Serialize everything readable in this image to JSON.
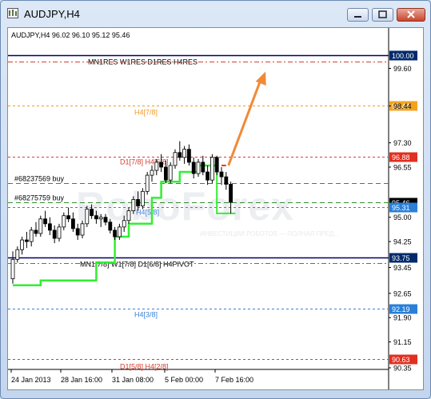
{
  "window": {
    "title": "AUDJPY,H4",
    "buttons": [
      "minimize",
      "maximize",
      "close"
    ]
  },
  "chart_info": "AUDJPY,H4  96.02 96.10 95.12 95.46",
  "watermark": "RoboForex",
  "watermark_sub": "ИНВЕСТИЦИИ РОБОТОВ — ПОЛНАЯ ПРЕД...",
  "colors": {
    "bg": "#ffffff",
    "candle": "#000000",
    "ma": "#33ee33",
    "red": "#d64030",
    "orange": "#f39a2a",
    "green_dash": "#2f8f2f",
    "blue_dash": "#3a7fd6",
    "navy": "#000066",
    "arrow": "#f08a38",
    "label_navy": "#002a6b",
    "label_red": "#e03020",
    "label_orange": "#f4a21c",
    "label_blue": "#2a7fd8",
    "label_dark": "#000000"
  },
  "chart_data": {
    "type": "candlestick",
    "symbol": "AUDJPY",
    "timeframe": "H4",
    "y_ticks": [
      "99.60",
      "98.44",
      "97.30",
      "96.55",
      "95.00",
      "94.25",
      "93.45",
      "92.65",
      "91.90",
      "91.15",
      "90.35"
    ],
    "y_range": [
      90.35,
      100.6
    ],
    "x_ticks": [
      "24 Jan 2013",
      "28 Jan 16:00",
      "31 Jan 08:00",
      "5 Feb 00:00",
      "7 Feb 16:00"
    ],
    "levels": [
      {
        "price": 100.0,
        "text": "MN1RES W1RES D1RES H4RES",
        "label": "100.00",
        "kind": "navy"
      },
      {
        "price": 99.82,
        "text": "",
        "label": "",
        "kind": "reddash"
      },
      {
        "price": 98.44,
        "text": "H4[7/8]",
        "label": "98.44",
        "kind": "orange"
      },
      {
        "price": 96.88,
        "text": "D1[7/8] H4[6/8]",
        "label": "96.88",
        "kind": "red"
      },
      {
        "price": 96.05,
        "text": "#68237569 buy",
        "label": "",
        "kind": "green"
      },
      {
        "price": 95.46,
        "text": "#68275759 buy",
        "label": "95.46",
        "kind": "greenblack"
      },
      {
        "price": 95.31,
        "text": "H4[5/8]",
        "label": "95.31",
        "kind": "blue"
      },
      {
        "price": 93.75,
        "text": "MN1[7/8] W1[7/8] D1[6/8] H4PIVOT",
        "label": "93.75",
        "kind": "navy"
      },
      {
        "price": 93.58,
        "text": "",
        "label": "",
        "kind": "reddash"
      },
      {
        "price": 92.19,
        "text": "H4[3/8]",
        "label": "92.19",
        "kind": "blue"
      },
      {
        "price": 90.63,
        "text": "D1[5/8] H4[2/8]",
        "label": "90.63",
        "kind": "red"
      }
    ],
    "candles": [
      [
        93.1,
        93.95,
        92.95,
        93.7
      ],
      [
        93.7,
        94.1,
        93.6,
        94.0
      ],
      [
        94.0,
        94.4,
        93.85,
        94.3
      ],
      [
        94.3,
        94.55,
        94.05,
        94.25
      ],
      [
        94.25,
        94.7,
        94.1,
        94.6
      ],
      [
        94.6,
        94.85,
        94.4,
        94.5
      ],
      [
        94.5,
        95.05,
        94.4,
        94.95
      ],
      [
        94.95,
        95.2,
        94.7,
        94.8
      ],
      [
        94.8,
        95.0,
        94.45,
        94.6
      ],
      [
        94.6,
        94.75,
        94.2,
        94.35
      ],
      [
        94.35,
        94.8,
        94.25,
        94.7
      ],
      [
        94.7,
        95.15,
        94.6,
        95.05
      ],
      [
        95.05,
        95.3,
        94.85,
        94.95
      ],
      [
        94.95,
        95.15,
        94.55,
        94.65
      ],
      [
        94.65,
        94.8,
        94.3,
        94.45
      ],
      [
        94.45,
        94.9,
        94.35,
        94.8
      ],
      [
        94.8,
        95.35,
        94.7,
        95.25
      ],
      [
        95.25,
        95.4,
        94.95,
        95.05
      ],
      [
        95.05,
        95.2,
        94.8,
        94.95
      ],
      [
        94.95,
        95.1,
        94.7,
        95.0
      ],
      [
        95.0,
        95.1,
        94.75,
        94.85
      ],
      [
        94.85,
        94.95,
        94.5,
        94.6
      ],
      [
        94.6,
        94.7,
        94.3,
        94.4
      ],
      [
        94.4,
        94.8,
        94.3,
        94.7
      ],
      [
        94.7,
        95.05,
        94.55,
        94.9
      ],
      [
        94.9,
        95.3,
        94.8,
        95.2
      ],
      [
        95.2,
        95.65,
        95.1,
        95.55
      ],
      [
        95.55,
        95.8,
        95.2,
        95.35
      ],
      [
        95.35,
        95.9,
        95.25,
        95.8
      ],
      [
        95.8,
        96.4,
        95.7,
        96.3
      ],
      [
        96.3,
        96.6,
        96.1,
        96.45
      ],
      [
        96.45,
        96.8,
        96.3,
        96.7
      ],
      [
        96.7,
        96.95,
        96.4,
        96.55
      ],
      [
        96.55,
        96.75,
        96.05,
        96.15
      ],
      [
        96.15,
        96.7,
        96.05,
        96.6
      ],
      [
        96.6,
        97.1,
        96.5,
        97.0
      ],
      [
        97.0,
        97.35,
        96.75,
        96.85
      ],
      [
        96.85,
        97.2,
        96.65,
        97.1
      ],
      [
        97.1,
        97.25,
        96.6,
        96.7
      ],
      [
        96.7,
        96.85,
        96.2,
        96.35
      ],
      [
        96.35,
        96.8,
        96.25,
        96.7
      ],
      [
        96.7,
        96.9,
        96.3,
        96.4
      ],
      [
        96.4,
        96.6,
        96.0,
        96.15
      ],
      [
        96.15,
        96.95,
        96.05,
        96.85
      ],
      [
        96.85,
        96.9,
        96.3,
        96.4
      ],
      [
        96.4,
        96.55,
        96.0,
        96.25
      ],
      [
        96.25,
        96.4,
        95.85,
        96.02
      ],
      [
        96.02,
        96.1,
        95.12,
        95.46
      ]
    ],
    "ma": [
      {
        "i": 0,
        "v": 92.9
      },
      {
        "i": 6,
        "v": 92.9
      },
      {
        "i": 6,
        "v": 93.05
      },
      {
        "i": 18,
        "v": 93.05
      },
      {
        "i": 18,
        "v": 93.6
      },
      {
        "i": 22,
        "v": 93.6
      },
      {
        "i": 22,
        "v": 94.4
      },
      {
        "i": 25,
        "v": 94.4
      },
      {
        "i": 25,
        "v": 94.8
      },
      {
        "i": 30,
        "v": 94.8
      },
      {
        "i": 30,
        "v": 95.6
      },
      {
        "i": 32,
        "v": 95.6
      },
      {
        "i": 32,
        "v": 96.1
      },
      {
        "i": 36,
        "v": 96.1
      },
      {
        "i": 36,
        "v": 96.4
      },
      {
        "i": 40,
        "v": 96.4
      },
      {
        "i": 40,
        "v": 96.6
      },
      {
        "i": 44,
        "v": 96.6
      }
    ],
    "ma_tail": {
      "from": 44,
      "to": 47,
      "v": 95.12
    },
    "arrow": {
      "from": [
        46.5,
        96.6
      ],
      "to": [
        54.5,
        99.5
      ]
    }
  }
}
